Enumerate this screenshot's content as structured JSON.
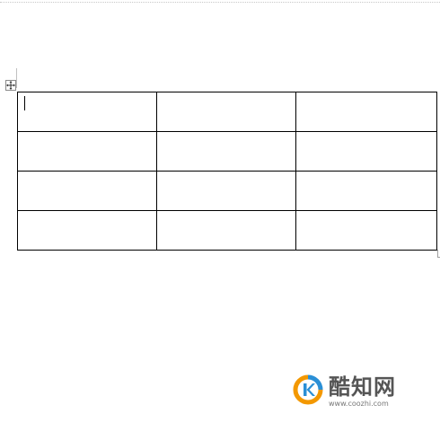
{
  "document": {
    "table": {
      "rows": [
        [
          "",
          "",
          ""
        ],
        [
          "",
          "",
          ""
        ],
        [
          "",
          "",
          ""
        ],
        [
          "",
          "",
          ""
        ]
      ]
    },
    "move_handle_icon": "four-arrow-move-icon"
  },
  "watermark": {
    "logo_icon": "coozhi-logo-icon",
    "title": "酷知网",
    "url": "www.coozhi.com",
    "colors": {
      "orange": "#f39800",
      "blue": "#2a8fd6"
    }
  }
}
